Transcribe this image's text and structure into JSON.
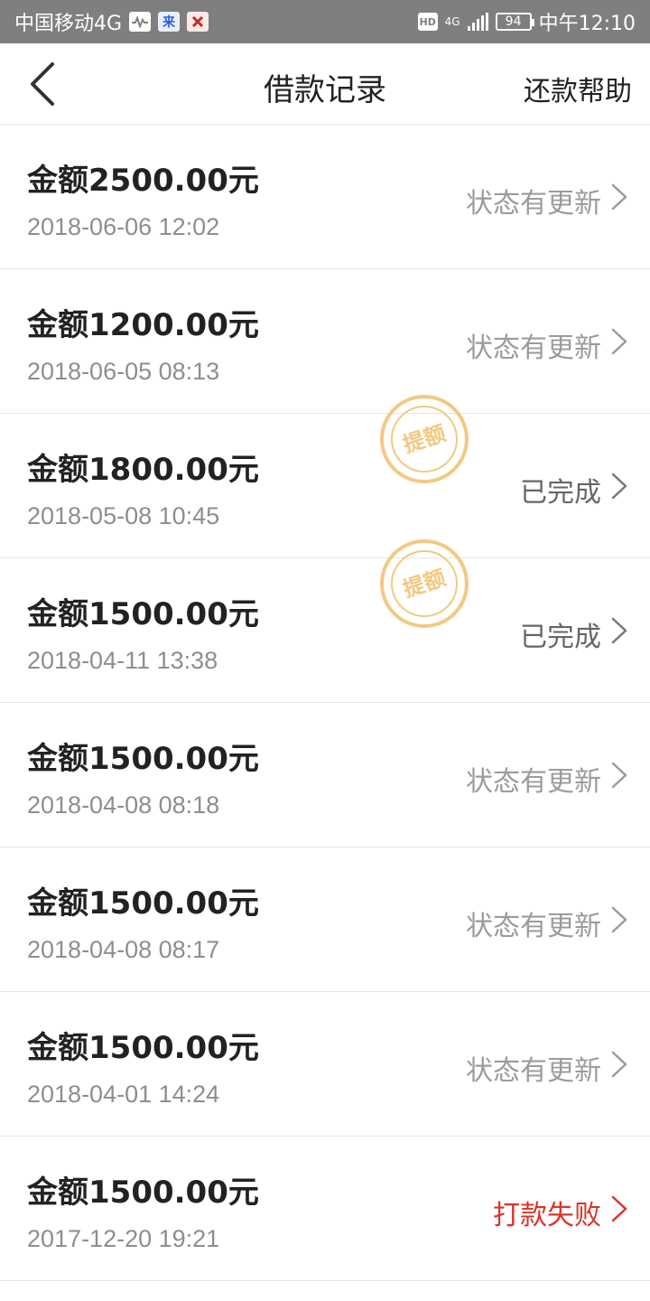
{
  "statusbar": {
    "carrier": "中国移动4G",
    "app_badge_1": "来",
    "app_badge_2": "ᅟ",
    "hd": "HD",
    "network": "4G",
    "battery": "94",
    "time": "中午12:10"
  },
  "nav": {
    "title": "借款记录",
    "help": "还款帮助"
  },
  "stamp_text": "提额",
  "records": [
    {
      "amount": "金额2500.00元",
      "time": "2018-06-06 12:02",
      "status": "状态有更新",
      "state": "update",
      "stamp": false
    },
    {
      "amount": "金额1200.00元",
      "time": "2018-06-05 08:13",
      "status": "状态有更新",
      "state": "update",
      "stamp": false
    },
    {
      "amount": "金额1800.00元",
      "time": "2018-05-08 10:45",
      "status": "已完成",
      "state": "done",
      "stamp": true
    },
    {
      "amount": "金额1500.00元",
      "time": "2018-04-11 13:38",
      "status": "已完成",
      "state": "done",
      "stamp": true
    },
    {
      "amount": "金额1500.00元",
      "time": "2018-04-08 08:18",
      "status": "状态有更新",
      "state": "update",
      "stamp": false
    },
    {
      "amount": "金额1500.00元",
      "time": "2018-04-08 08:17",
      "status": "状态有更新",
      "state": "update",
      "stamp": false
    },
    {
      "amount": "金额1500.00元",
      "time": "2018-04-01 14:24",
      "status": "状态有更新",
      "state": "update",
      "stamp": false
    },
    {
      "amount": "金额1500.00元",
      "time": "2017-12-20 19:21",
      "status": "打款失败",
      "state": "fail",
      "stamp": false
    }
  ],
  "colors": {
    "statusbar_bg": "#7f7f7f",
    "fail_red": "#d9342b",
    "stamp_gold": "#f2c982",
    "muted_text": "#9b9b9b"
  }
}
